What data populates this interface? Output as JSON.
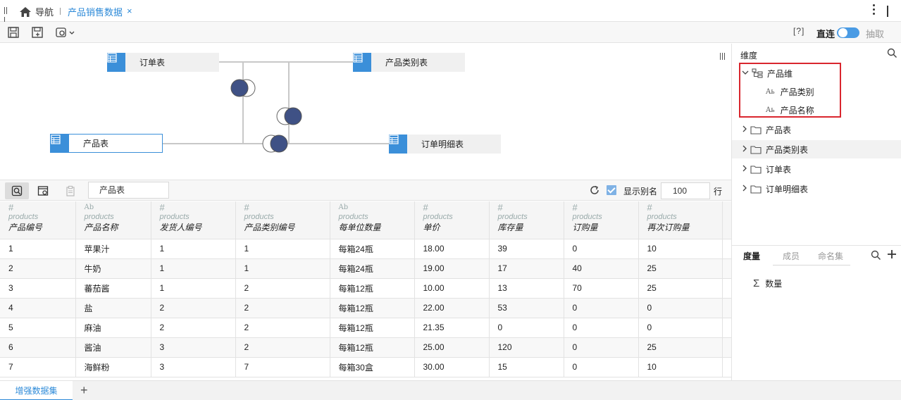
{
  "tabbar": {
    "home_label": "导航",
    "active_tab": "产品销售数据",
    "close_glyph": "×"
  },
  "toolbar": {
    "help_label": "[?]",
    "direct_label": "直连",
    "extract_label": "抽取",
    "direct_enabled": true
  },
  "diagram": {
    "tables": [
      {
        "label": "订单表"
      },
      {
        "label": "产品类别表"
      },
      {
        "label": "产品表"
      },
      {
        "label": "订单明细表"
      }
    ]
  },
  "gridbar": {
    "table_name": "产品表",
    "alias_label": "显示别名",
    "alias_checked": true,
    "rows_value": "100",
    "rows_suffix": "行"
  },
  "grid": {
    "columns": [
      {
        "type": "#",
        "source": "products",
        "name": "产品编号"
      },
      {
        "type": "Ab",
        "source": "products",
        "name": "产品名称"
      },
      {
        "type": "#",
        "source": "products",
        "name": "发货人编号"
      },
      {
        "type": "#",
        "source": "products",
        "name": "产品类别编号"
      },
      {
        "type": "Ab",
        "source": "products",
        "name": "每单位数量"
      },
      {
        "type": "#",
        "source": "products",
        "name": "单价"
      },
      {
        "type": "#",
        "source": "products",
        "name": "库存量"
      },
      {
        "type": "#",
        "source": "products",
        "name": "订购量"
      },
      {
        "type": "#",
        "source": "products",
        "name": "再次订购量"
      },
      {
        "type": "",
        "source": "",
        "name": ""
      }
    ],
    "rows": [
      [
        "1",
        "苹果汁",
        "1",
        "1",
        "每箱24瓶",
        "18.00",
        "39",
        "0",
        "10",
        ""
      ],
      [
        "2",
        "牛奶",
        "1",
        "1",
        "每箱24瓶",
        "19.00",
        "17",
        "40",
        "25",
        ""
      ],
      [
        "3",
        "蕃茄酱",
        "1",
        "2",
        "每箱12瓶",
        "10.00",
        "13",
        "70",
        "25",
        ""
      ],
      [
        "4",
        "盐",
        "2",
        "2",
        "每箱12瓶",
        "22.00",
        "53",
        "0",
        "0",
        ""
      ],
      [
        "5",
        "麻油",
        "2",
        "2",
        "每箱12瓶",
        "21.35",
        "0",
        "0",
        "0",
        ""
      ],
      [
        "6",
        "酱油",
        "3",
        "2",
        "每箱12瓶",
        "25.00",
        "120",
        "0",
        "25",
        ""
      ],
      [
        "7",
        "海鲜粉",
        "3",
        "7",
        "每箱30盒",
        "30.00",
        "15",
        "0",
        "10",
        ""
      ]
    ]
  },
  "rpanel": {
    "title": "维度",
    "dimension_group": "产品维",
    "dimension_children": [
      "产品类别",
      "产品名称"
    ],
    "folders": [
      "产品表",
      "产品类别表",
      "订单表",
      "订单明细表"
    ],
    "measure_tabs": [
      "度量",
      "成员",
      "命名集"
    ],
    "measure_item": "数量"
  },
  "bottom": {
    "tab_label": "增强数据集",
    "add_glyph": "+"
  },
  "colors": {
    "accent": "#2d8ad8",
    "highlight": "#d9262e",
    "join": "#3f5185"
  }
}
